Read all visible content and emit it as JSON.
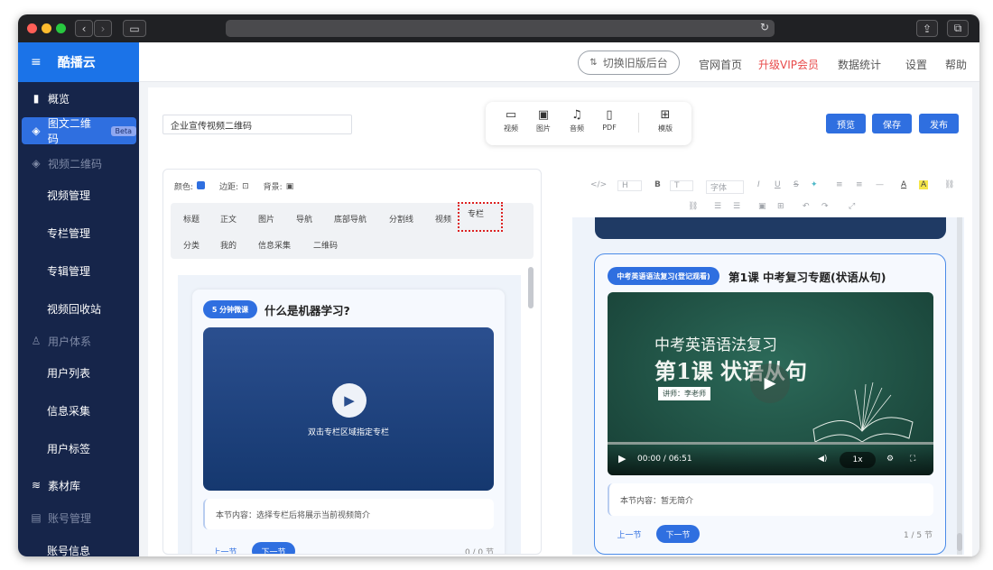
{
  "header": {
    "switch_label": "切换旧版后台",
    "links": [
      "官网首页",
      "升级VIP会员",
      "数据统计",
      "设置",
      "帮助"
    ]
  },
  "sidebar": {
    "brand": "酷播云",
    "items": [
      {
        "label": "概览"
      },
      {
        "label": "图文二维码",
        "badge": "Beta"
      },
      {
        "label": "视频二维码"
      },
      {
        "label": "视频管理"
      },
      {
        "label": "专栏管理"
      },
      {
        "label": "专辑管理"
      },
      {
        "label": "视频回收站"
      },
      {
        "label": "用户体系"
      },
      {
        "label": "用户列表"
      },
      {
        "label": "信息采集"
      },
      {
        "label": "用户标签"
      },
      {
        "label": "素材库"
      },
      {
        "label": "账号管理"
      },
      {
        "label": "账号信息"
      }
    ]
  },
  "editor": {
    "title_value": "企业宣传视频二维码",
    "tools": [
      "视频",
      "图片",
      "音频",
      "PDF",
      "模版"
    ],
    "actions": {
      "preview": "预览",
      "save": "保存",
      "publish": "发布"
    },
    "props": {
      "color": "颜色:",
      "border": "边距:",
      "background": "背景:"
    },
    "components": [
      "标题",
      "正文",
      "图片",
      "导航",
      "底部导航",
      "分割线",
      "视频",
      "专栏",
      "分类",
      "我的",
      "信息采集",
      "二维码"
    ]
  },
  "left_card": {
    "badge": "5 分钟微课",
    "title": "什么是机器学习?",
    "video_hint": "双击专栏区域指定专栏",
    "intro": "本节内容：选择专栏后将展示当前视频简介",
    "prev": "上一节",
    "next": "下一节",
    "count": "0 / 0 节"
  },
  "rte_toolbar": {
    "row1": [
      "</>",
      "H",
      "B",
      "T",
      "字体",
      "I",
      "U",
      "S",
      "A",
      "A"
    ],
    "row2": []
  },
  "right_card": {
    "badge": "中考英语语法复习(登记观看)",
    "title": "第1课 中考复习专题(状语从句)",
    "board_line1": "中考英语语法复习",
    "board_line2": "第1课  状语从句",
    "board_teacher": "讲师：李老师",
    "time": "00:00 / 06:51",
    "speed": "1x",
    "intro": "本节内容：暂无简介",
    "prev": "上一节",
    "next": "下一节",
    "count": "1 / 5 节"
  },
  "colors": {
    "accent": "#2f6fe0",
    "sidebar": "#16254a",
    "vip": "#e84a4a"
  }
}
